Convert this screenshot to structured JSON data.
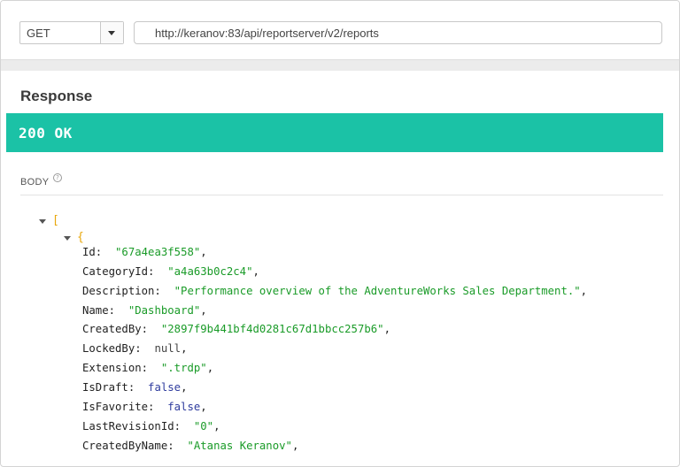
{
  "request": {
    "method": "GET",
    "url": "http://keranov:83/api/reportserver/v2/reports"
  },
  "response": {
    "heading": "Response",
    "status": "200 OK",
    "body_label": "BODY",
    "help_glyph": "?",
    "open_array": "[",
    "open_object": "{",
    "fields": [
      {
        "key": "Id:",
        "value": "\"67a4ea3f558\"",
        "sep": ",",
        "type": "string"
      },
      {
        "key": "CategoryId:",
        "value": "\"a4a63b0c2c4\"",
        "sep": ",",
        "type": "string"
      },
      {
        "key": "Description:",
        "value": "\"Performance overview of the AdventureWorks Sales Department.\"",
        "sep": ",",
        "type": "string"
      },
      {
        "key": "Name:",
        "value": "\"Dashboard\"",
        "sep": ",",
        "type": "string"
      },
      {
        "key": "CreatedBy:",
        "value": "\"2897f9b441bf4d0281c67d1bbcc257b6\"",
        "sep": ",",
        "type": "string"
      },
      {
        "key": "LockedBy:",
        "value": "null",
        "sep": ",",
        "type": "null"
      },
      {
        "key": "Extension:",
        "value": "\".trdp\"",
        "sep": ",",
        "type": "string"
      },
      {
        "key": "IsDraft:",
        "value": "false",
        "sep": ",",
        "type": "bool"
      },
      {
        "key": "IsFavorite:",
        "value": "false",
        "sep": ",",
        "type": "bool"
      },
      {
        "key": "LastRevisionId:",
        "value": "\"0\"",
        "sep": ",",
        "type": "string"
      },
      {
        "key": "CreatedByName:",
        "value": "\"Atanas Keranov\"",
        "sep": ",",
        "type": "string"
      }
    ]
  },
  "colors": {
    "status_bar": "#1bc2a6",
    "string_value": "#1a9b28",
    "keyword_value": "#2f3c9e",
    "bracket": "#e8a70b"
  }
}
